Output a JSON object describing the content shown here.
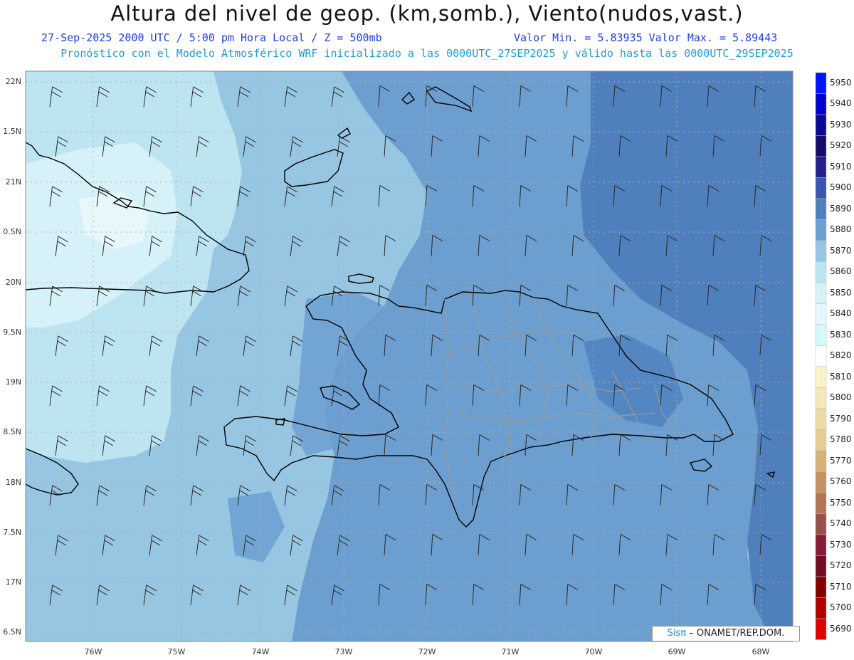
{
  "header": {
    "title": "Altura del nivel de geop. (km,somb.), Viento(nudos,vast.)",
    "subtitle_left": "27-Sep-2025  2000 UTC / 5:00 pm Hora Local / Z = 500mb",
    "subtitle_right": "Valor Min. = 5.83935  Valor Max. = 5.89443",
    "subtitle2": "Pronóstico con el Modelo Atmosférico WRF inicializado a las 0000UTC_27SEP2025 y válido hasta las  0000UTC_29SEP2025"
  },
  "axes": {
    "lat_labels": [
      "22N",
      "1.5N",
      "21N",
      "0.5N",
      "20N",
      "9.5N",
      "19N",
      "8.5N",
      "18N",
      "7.5N",
      "17N",
      "6.5N"
    ],
    "lon_labels": [
      "76W",
      "75W",
      "74W",
      "73W",
      "72W",
      "71W",
      "70W",
      "69W",
      "68W"
    ]
  },
  "colorbar": {
    "levels": [
      "5950",
      "5940",
      "5930",
      "5920",
      "5910",
      "5900",
      "5890",
      "5880",
      "5870",
      "5860",
      "5850",
      "5840",
      "5830",
      "5820",
      "5810",
      "5800",
      "5790",
      "5780",
      "5770",
      "5760",
      "5750",
      "5740",
      "5730",
      "5720",
      "5710",
      "5700",
      "5690"
    ],
    "colors": [
      "#0014ff",
      "#0000d0",
      "#0b0a90",
      "#180c6a",
      "#22208a",
      "#3856ae",
      "#4f7fbd",
      "#6c9fd0",
      "#96c6e2",
      "#bde5f1",
      "#d6f1f8",
      "#e6f8fb",
      "#d4fafc",
      "#ffffff",
      "#fbf3c9",
      "#f4e8b8",
      "#ecdba6",
      "#e5cc92",
      "#d7b07a",
      "#c59362",
      "#b07752",
      "#99504a",
      "#841c38",
      "#720e22",
      "#820000",
      "#b00000",
      "#e00000"
    ]
  },
  "credit": {
    "sis": "Sisπ",
    "org": "– ONAMET/REP.DOM."
  },
  "map_colors": {
    "land_outline": "#000000",
    "province_lines": "#9a9a9a",
    "grid": "#b0b0b0",
    "barb": "#2a2a2a"
  }
}
